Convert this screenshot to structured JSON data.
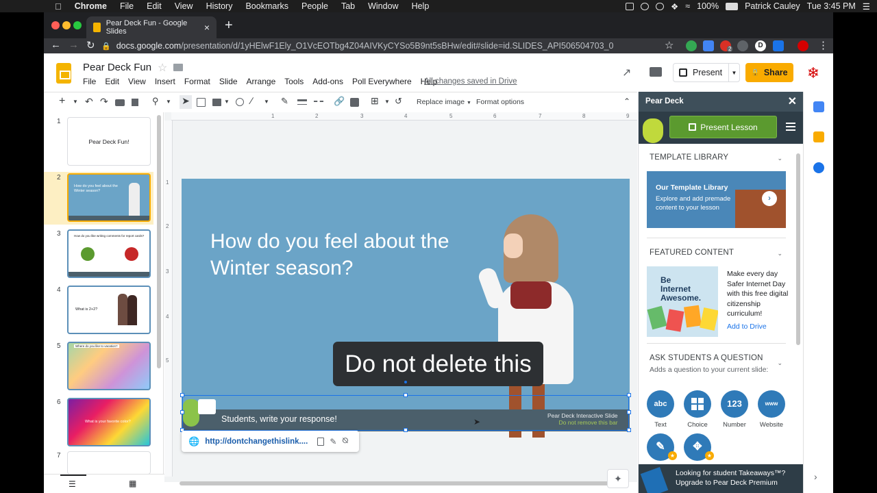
{
  "menubar": {
    "app": "Chrome",
    "items": [
      "File",
      "Edit",
      "View",
      "History",
      "Bookmarks",
      "People",
      "Tab",
      "Window",
      "Help"
    ],
    "battery": "100%",
    "user": "Patrick Cauley",
    "clock": "Tue 3:45 PM"
  },
  "browser": {
    "tab_title": "Pear Deck Fun - Google Slides",
    "url_host": "docs.google.com",
    "url_path": "/presentation/d/1yHElwF1Ely_O1VcEOTbg4Z04AIVKyCYSo5B9nt5sBHw/edit#slide=id.SLIDES_API506504703_0",
    "ext_badge": "2",
    "profile_initial": "D"
  },
  "slides": {
    "doc_title": "Pear Deck Fun",
    "menus": [
      "File",
      "Edit",
      "View",
      "Insert",
      "Format",
      "Slide",
      "Arrange",
      "Tools",
      "Add-ons",
      "Poll Everywhere",
      "Help"
    ],
    "saved_status": "All changes saved in Drive",
    "present_label": "Present",
    "share_label": "Share",
    "toolbar": {
      "replace_image": "Replace image",
      "format_options": "Format options"
    },
    "filmstrip": [
      {
        "num": "1",
        "text": "Pear Deck Fun!"
      },
      {
        "num": "2",
        "text": "How do you feel about the Winter season?"
      },
      {
        "num": "3",
        "text": "How do you like writing comments for report cards?"
      },
      {
        "num": "4",
        "text": "What is 2+2?"
      },
      {
        "num": "5",
        "text": "Where do you like to vacation?"
      },
      {
        "num": "6",
        "text": "What is your favorite color?"
      },
      {
        "num": "7",
        "text": ""
      }
    ],
    "ruler_marks": [
      "1",
      "2",
      "3",
      "4",
      "5",
      "6",
      "7",
      "8",
      "9"
    ],
    "ruler_v_marks": [
      "1",
      "2",
      "3",
      "4",
      "5"
    ],
    "slide": {
      "question": "How do you feel about the Winter season?",
      "overlay": "Do not delete this",
      "students_write": "Students, write your response!",
      "pd_interactive": "Pear Deck Interactive Slide",
      "pd_do_not_remove": "Do not remove this bar"
    },
    "link_popup": {
      "url": "http://dontchangethislink...."
    }
  },
  "peardeck": {
    "title": "Pear Deck",
    "present_lesson": "Present Lesson",
    "template_library": {
      "heading": "TEMPLATE LIBRARY",
      "card_title": "Our Template Library",
      "card_text": "Explore and add premade content to your lesson"
    },
    "featured": {
      "heading": "FEATURED CONTENT",
      "image_text": "Be Internet Awesome.",
      "text": "Make every day Safer Internet Day with this free digital citizenship curriculum!",
      "add_link": "Add to Drive"
    },
    "ask": {
      "heading": "ASK STUDENTS A QUESTION",
      "sub": "Adds a question to your current slide:",
      "buttons": [
        {
          "icon": "abc",
          "label": "Text"
        },
        {
          "icon": "",
          "label": "Choice"
        },
        {
          "icon": "123",
          "label": "Number"
        },
        {
          "icon": "www",
          "label": "Website"
        }
      ]
    },
    "promo": {
      "line1": "Looking for student Takeaways™?",
      "line2": "Upgrade to Pear Deck Premium"
    }
  },
  "colors": {
    "slide_bg": "#6ba4c7",
    "pear_bar": "#4b5f6b",
    "share": "#f9ab00",
    "pd_green": "#5b9a2f",
    "q_blue": "#2f7ab8"
  }
}
